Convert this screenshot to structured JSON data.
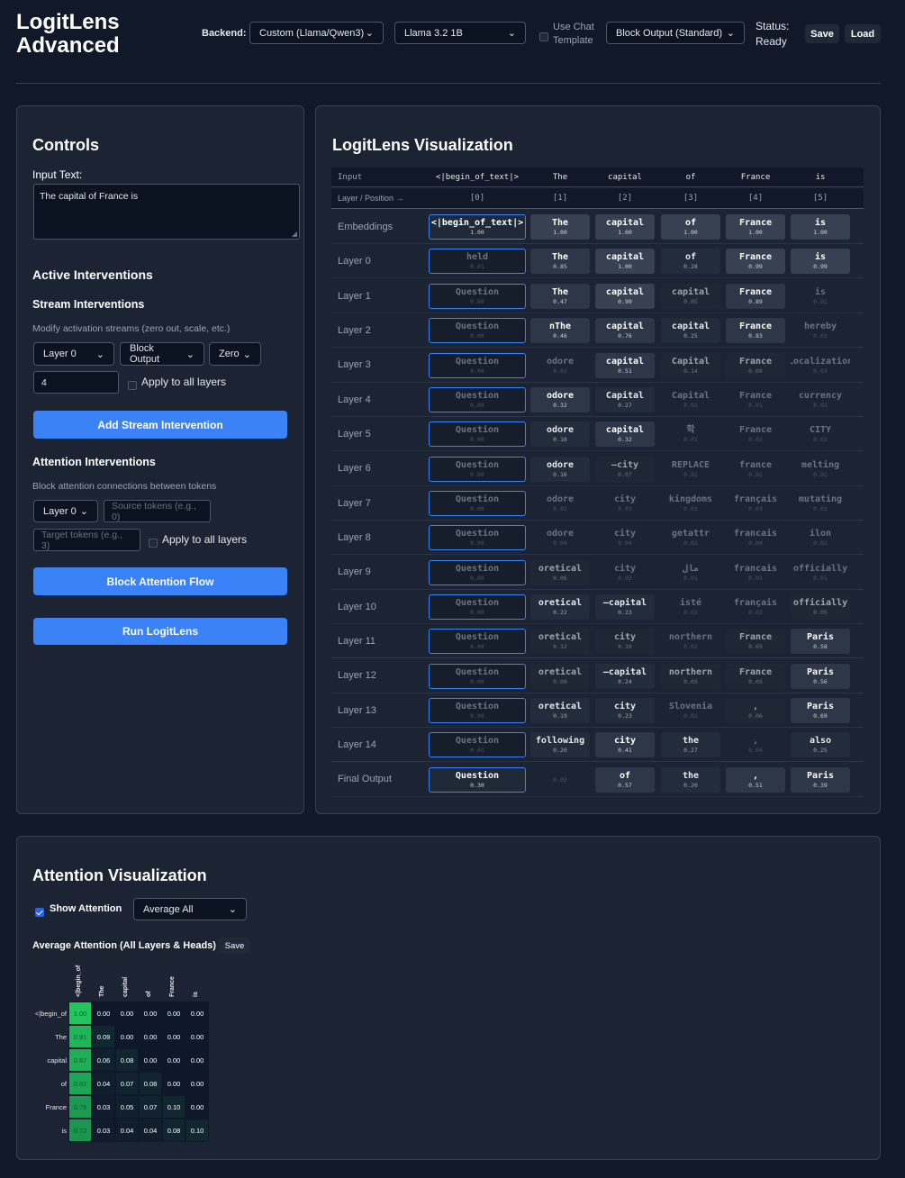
{
  "header": {
    "title_line1": "LogitLens",
    "title_line2": "Advanced",
    "backend_label": "Backend:",
    "backend_value": "Custom (Llama/Qwen3)",
    "model_value": "Llama 3.2 1B",
    "chat_template_line1": "Use Chat",
    "chat_template_line2": "Template",
    "chat_template_checked": false,
    "mode_value": "Block Output (Standard)",
    "status_line1": "Status:",
    "status_line2": "Ready",
    "save_label": "Save",
    "load_label": "Load"
  },
  "controls": {
    "title": "Controls",
    "input_label": "Input Text:",
    "input_value": "The capital of France is",
    "active_title": "Active Interventions",
    "stream_title": "Stream Interventions",
    "stream_desc": "Modify activation streams (zero out, scale, etc.)",
    "stream_layer": "Layer 0",
    "stream_component": "Block Output",
    "stream_op": "Zero",
    "stream_value": "4",
    "apply_all_label": "Apply to all layers",
    "add_stream_label": "Add Stream Intervention",
    "attention_title": "Attention Interventions",
    "attention_desc": "Block attention connections between tokens",
    "attn_layer": "Layer 0",
    "source_placeholder": "Source tokens (e.g., 0)",
    "target_placeholder": "Target tokens (e.g., 3)",
    "attn_apply_all_label": "Apply to all layers",
    "block_label": "Block Attention Flow",
    "run_label": "Run LogitLens"
  },
  "viz": {
    "title": "LogitLens Visualization",
    "input_header": "Input",
    "pos_header": "Layer / Position →",
    "tokens": [
      "<|begin_of_text|>",
      "The",
      "capital",
      "of",
      "France",
      "is"
    ],
    "positions": [
      "[0]",
      "[1]",
      "[2]",
      "[3]",
      "[4]",
      "[5]"
    ],
    "rows": [
      {
        "label": "Embeddings",
        "cells": [
          [
            "<|begin_of_text|>",
            "1.00"
          ],
          [
            "The",
            "1.00"
          ],
          [
            "capital",
            "1.00"
          ],
          [
            "of",
            "1.00"
          ],
          [
            "France",
            "1.00"
          ],
          [
            "is",
            "1.00"
          ]
        ]
      },
      {
        "label": "Layer 0",
        "cells": [
          [
            "held",
            "0.01"
          ],
          [
            "The",
            "0.85"
          ],
          [
            "capital",
            "1.00"
          ],
          [
            "of",
            "0.28"
          ],
          [
            "France",
            "0.99"
          ],
          [
            "is",
            "0.99"
          ]
        ]
      },
      {
        "label": "Layer 1",
        "cells": [
          [
            "Question",
            "0.00"
          ],
          [
            "The",
            "0.47"
          ],
          [
            "capital",
            "0.99"
          ],
          [
            "capital",
            "0.05"
          ],
          [
            "France",
            "0.89"
          ],
          [
            "is",
            "0.01"
          ]
        ]
      },
      {
        "label": "Layer 2",
        "cells": [
          [
            "Question",
            "0.00"
          ],
          [
            "nThe",
            "0.46"
          ],
          [
            "capital",
            "0.76"
          ],
          [
            "capital",
            "0.25"
          ],
          [
            "France",
            "0.83"
          ],
          [
            "hereby",
            "0.01"
          ]
        ]
      },
      {
        "label": "Layer 3",
        "cells": [
          [
            "Question",
            "0.00"
          ],
          [
            "odore",
            "0.02"
          ],
          [
            "capital",
            "0.51"
          ],
          [
            "Capital",
            "0.14"
          ],
          [
            "France",
            "0.09"
          ],
          [
            "Localization",
            "0.03"
          ]
        ]
      },
      {
        "label": "Layer 4",
        "cells": [
          [
            "Question",
            "0.00"
          ],
          [
            "odore",
            "0.32"
          ],
          [
            "Capital",
            "0.27"
          ],
          [
            "Capital",
            "0.02"
          ],
          [
            "France",
            "0.01"
          ],
          [
            "currency",
            "0.02"
          ]
        ]
      },
      {
        "label": "Layer 5",
        "cells": [
          [
            "Question",
            "0.00"
          ],
          [
            "odore",
            "0.18"
          ],
          [
            "capital",
            "0.32"
          ],
          [
            "학",
            "0.01"
          ],
          [
            "France",
            "0.02"
          ],
          [
            "CITY",
            "0.03"
          ]
        ]
      },
      {
        "label": "Layer 6",
        "cells": [
          [
            "Question",
            "0.00"
          ],
          [
            "odore",
            "0.16"
          ],
          [
            "—city",
            "0.07"
          ],
          [
            "REPLACE",
            "0.01"
          ],
          [
            "france",
            "0.01"
          ],
          [
            "melting",
            "0.01"
          ]
        ]
      },
      {
        "label": "Layer 7",
        "cells": [
          [
            "Question",
            "0.00"
          ],
          [
            "odore",
            "0.02"
          ],
          [
            "city",
            "0.03"
          ],
          [
            "kingdoms",
            "0.01"
          ],
          [
            "français",
            "0.03"
          ],
          [
            "mutating",
            "0.01"
          ]
        ]
      },
      {
        "label": "Layer 8",
        "cells": [
          [
            "Question",
            "0.00"
          ],
          [
            "odore",
            "0.04"
          ],
          [
            "city",
            "0.04"
          ],
          [
            "getattr",
            "0.02"
          ],
          [
            "francais",
            "0.04"
          ],
          [
            "ilon",
            "0.02"
          ]
        ]
      },
      {
        "label": "Layer 9",
        "cells": [
          [
            "Question",
            "0.00"
          ],
          [
            "oretical",
            "0.06"
          ],
          [
            "city",
            "0.02"
          ],
          [
            "مال",
            "0.01"
          ],
          [
            "francais",
            "0.03"
          ],
          [
            "officially",
            "0.01"
          ]
        ]
      },
      {
        "label": "Layer 10",
        "cells": [
          [
            "Question",
            "0.00"
          ],
          [
            "oretical",
            "0.22"
          ],
          [
            "—capital",
            "0.23"
          ],
          [
            "isté",
            "0.03"
          ],
          [
            "français",
            "0.03"
          ],
          [
            "officially",
            "0.05"
          ]
        ]
      },
      {
        "label": "Layer 11",
        "cells": [
          [
            "Question",
            "0.00"
          ],
          [
            "oretical",
            "0.12"
          ],
          [
            "city",
            "0.10"
          ],
          [
            "northern",
            "0.02"
          ],
          [
            "France",
            "0.05"
          ],
          [
            "Paris",
            "0.58"
          ]
        ]
      },
      {
        "label": "Layer 12",
        "cells": [
          [
            "Question",
            "0.00"
          ],
          [
            "oretical",
            "0.08"
          ],
          [
            "—capital",
            "0.24"
          ],
          [
            "northern",
            "0.05"
          ],
          [
            "France",
            "0.05"
          ],
          [
            "Paris",
            "0.56"
          ]
        ]
      },
      {
        "label": "Layer 13",
        "cells": [
          [
            "Question",
            "0.00"
          ],
          [
            "oretical",
            "0.19"
          ],
          [
            "city",
            "0.23"
          ],
          [
            "Slovenia",
            "0.02"
          ],
          [
            ",",
            "0.06"
          ],
          [
            "Paris",
            "0.69"
          ]
        ]
      },
      {
        "label": "Layer 14",
        "cells": [
          [
            "Question",
            "0.01"
          ],
          [
            "following",
            "0.20"
          ],
          [
            "city",
            "0.41"
          ],
          [
            "the",
            "0.27"
          ],
          [
            ",",
            "0.04"
          ],
          [
            "also",
            "0.25"
          ]
        ]
      },
      {
        "label": "Final Output",
        "cells": [
          [
            "Question",
            "0.30"
          ],
          [
            "",
            "0.02"
          ],
          [
            "of",
            "0.57"
          ],
          [
            "the",
            "0.20"
          ],
          [
            ",",
            "0.51"
          ],
          [
            "Paris",
            "0.39"
          ]
        ]
      }
    ]
  },
  "attention": {
    "title": "Attention Visualization",
    "show_label": "Show Attention",
    "show_checked": true,
    "mode_value": "Average All",
    "heatmap_title": "Average Attention (All Layers & Heads)",
    "save_label": "Save",
    "col_labels": [
      "<|begin_of",
      "The",
      "capital",
      "of",
      "France",
      "is"
    ],
    "row_labels": [
      "<|begin_of",
      "The",
      "capital",
      "of",
      "France",
      "is"
    ],
    "matrix": [
      [
        "1.00",
        "0.00",
        "0.00",
        "0.00",
        "0.00",
        "0.00"
      ],
      [
        "0.91",
        "0.09",
        "0.00",
        "0.00",
        "0.00",
        "0.00"
      ],
      [
        "0.87",
        "0.06",
        "0.08",
        "0.00",
        "0.00",
        "0.00"
      ],
      [
        "0.82",
        "0.04",
        "0.07",
        "0.08",
        "0.00",
        "0.00"
      ],
      [
        "0.75",
        "0.03",
        "0.05",
        "0.07",
        "0.10",
        "0.00"
      ],
      [
        "0.72",
        "0.03",
        "0.04",
        "0.04",
        "0.08",
        "0.10"
      ]
    ]
  }
}
